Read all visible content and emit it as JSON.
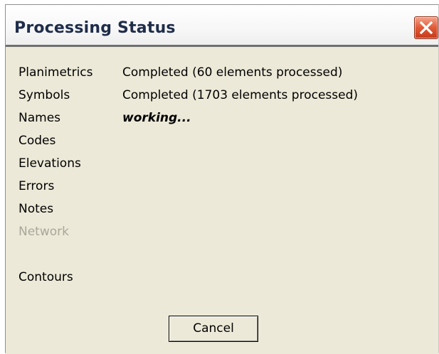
{
  "window": {
    "title": "Processing Status",
    "close_icon": "close-x-icon"
  },
  "status_rows": [
    {
      "label": "Planimetrics",
      "status": "Completed (60 elements processed)",
      "state": "completed"
    },
    {
      "label": "Symbols",
      "status": "Completed (1703 elements processed)",
      "state": "completed"
    },
    {
      "label": "Names",
      "status": "working...",
      "state": "working"
    },
    {
      "label": "Codes",
      "status": "",
      "state": "pending"
    },
    {
      "label": "Elevations",
      "status": "",
      "state": "pending"
    },
    {
      "label": "Errors",
      "status": "",
      "state": "pending"
    },
    {
      "label": "Notes",
      "status": "",
      "state": "pending"
    },
    {
      "label": "Network",
      "status": "",
      "state": "disabled"
    },
    {
      "label": "Contours",
      "status": "",
      "state": "pending"
    }
  ],
  "actions": {
    "cancel_label": "Cancel"
  },
  "colors": {
    "dialog_background": "#ece9d8",
    "title_text": "#1f2d4a",
    "close_button": "#e05a36",
    "disabled_text": "#a9a79b"
  }
}
